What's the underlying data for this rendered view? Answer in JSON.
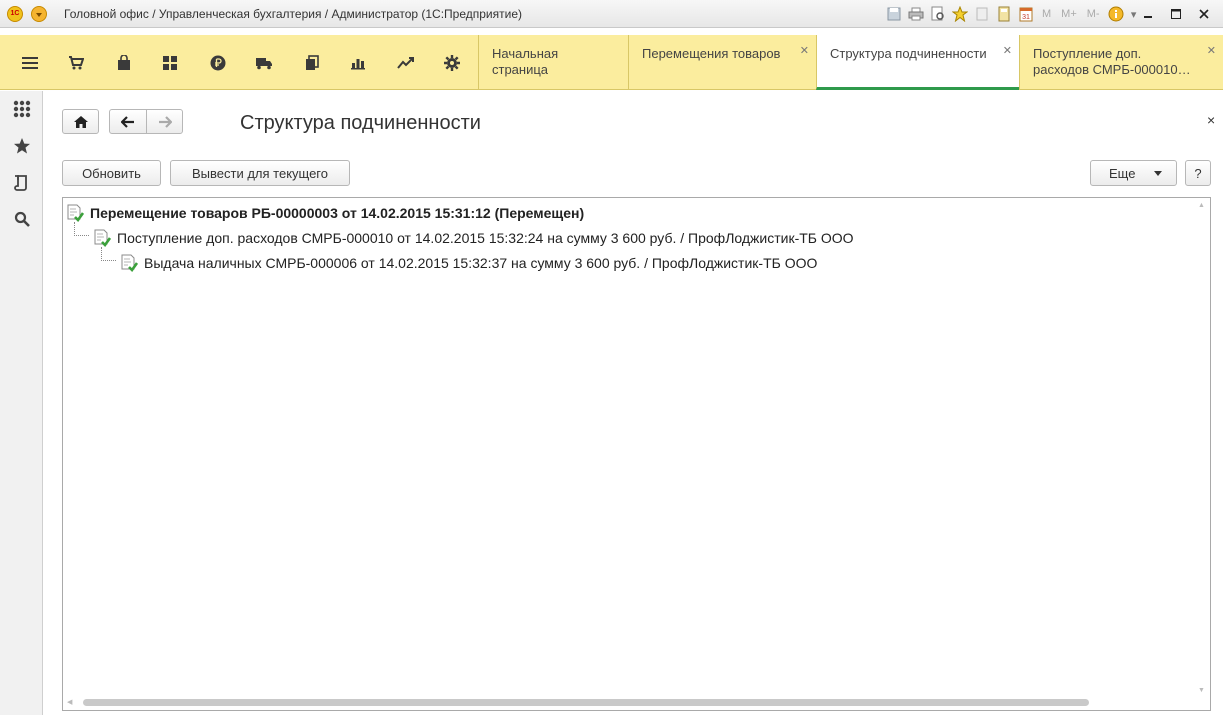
{
  "window": {
    "title": "Головной офис / Управленческая бухгалтерия / Администратор  (1С:Предприятие)",
    "logo_text": "1С",
    "toolbar_letters": [
      "M",
      "M+",
      "M-"
    ]
  },
  "sections": [
    {
      "name": "main-menu",
      "icon": "hamburger-icon"
    },
    {
      "name": "sales",
      "icon": "cart-icon"
    },
    {
      "name": "purchases",
      "icon": "bag-icon"
    },
    {
      "name": "warehouse",
      "icon": "grid-icon"
    },
    {
      "name": "finance",
      "icon": "ruble-icon"
    },
    {
      "name": "delivery",
      "icon": "truck-icon"
    },
    {
      "name": "documents",
      "icon": "documents-icon"
    },
    {
      "name": "reports",
      "icon": "bar-chart-icon"
    },
    {
      "name": "analytics",
      "icon": "trend-icon"
    },
    {
      "name": "settings",
      "icon": "gear-icon"
    }
  ],
  "tabs": [
    {
      "label": "Начальная страница",
      "closable": false,
      "active": false
    },
    {
      "label": "Перемещения товаров",
      "closable": true,
      "active": false
    },
    {
      "label": "Структура подчиненности",
      "closable": true,
      "active": true
    },
    {
      "label": "Поступление доп. расходов СМРБ-000010…",
      "closable": true,
      "active": false
    }
  ],
  "form": {
    "title": "Структура подчиненности",
    "refresh_label": "Обновить",
    "show_current_label": "Вывести для текущего",
    "more_label": "Еще",
    "help_label": "?",
    "close_label": "×"
  },
  "tree": [
    {
      "level": 0,
      "bold": true,
      "text": "Перемещение товаров РБ-00000003 от 14.02.2015 15:31:12 (Перемещен)"
    },
    {
      "level": 1,
      "bold": false,
      "text": "Поступление доп. расходов СМРБ-000010 от 14.02.2015 15:32:24 на сумму 3 600 руб. / ПрофЛоджистик-ТБ ООО"
    },
    {
      "level": 2,
      "bold": false,
      "text": "Выдача наличных СМРБ-000006 от 14.02.2015 15:32:37 на сумму 3 600 руб. / ПрофЛоджистик-ТБ ООО"
    }
  ],
  "colors": {
    "toolbar_bg": "#fbed9e",
    "active_tab_underline": "#2e9a4b",
    "doc_check": "#3ba03b"
  }
}
